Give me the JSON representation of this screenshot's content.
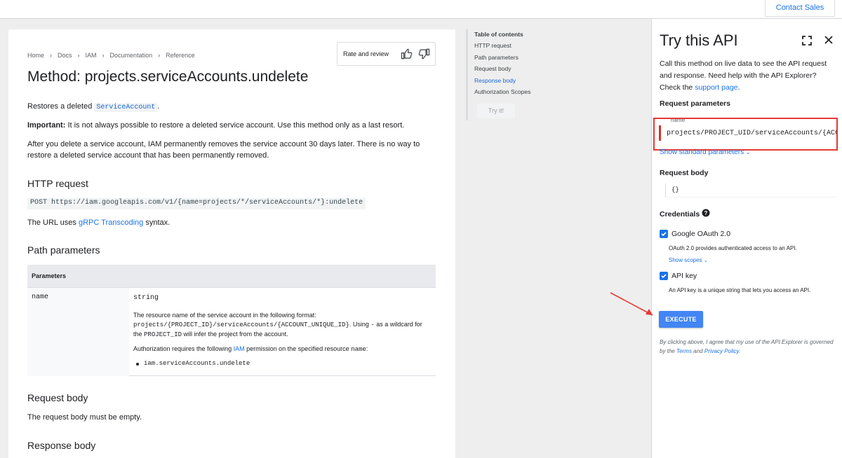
{
  "topbar": {
    "contact_sales": "Contact Sales"
  },
  "breadcrumb": [
    "Home",
    "Docs",
    "IAM",
    "Documentation",
    "Reference"
  ],
  "rate": {
    "label": "Rate and review"
  },
  "article": {
    "title": "Method: projects.serviceAccounts.undelete",
    "intro_prefix": "Restores a deleted ",
    "intro_code": "ServiceAccount",
    "intro_suffix": ".",
    "important_label": "Important:",
    "important_text": " It is not always possible to restore a deleted service account. Use this method only as a last resort.",
    "after_delete": "After you delete a service account, IAM permanently removes the service account 30 days later. There is no way to restore a deleted service account that has been permanently removed.",
    "http_heading": "HTTP request",
    "http_line": "POST https://iam.googleapis.com/v1/{name=projects/*/serviceAccounts/*}:undelete",
    "url_prefix": "The URL uses ",
    "url_link": "gRPC Transcoding",
    "url_suffix": " syntax.",
    "path_heading": "Path parameters",
    "table": {
      "header": "Parameters",
      "param_name": "name",
      "param_type": "string",
      "desc_1": "The resource name of the service account in the following format:",
      "desc_format": "projects/{PROJECT_ID}/serviceAccounts/{ACCOUNT_UNIQUE_ID}",
      "desc_using": ". Using ",
      "desc_dash": "-",
      "desc_wildcard": " as a wildcard for the ",
      "desc_project": "PROJECT_ID",
      "desc_infer": " will infer the project from the account.",
      "auth_prefix": "Authorization requires the following ",
      "auth_link": "IAM",
      "auth_suffix": " permission on the specified resource ",
      "auth_name": "name",
      "auth_end": ":",
      "permission": "iam.serviceAccounts.undelete"
    },
    "request_heading": "Request body",
    "request_text": "The request body must be empty.",
    "response_heading": "Response body"
  },
  "toc": {
    "title": "Table of contents",
    "items": [
      "HTTP request",
      "Path parameters",
      "Request body",
      "Response body",
      "Authorization Scopes"
    ],
    "active_index": 3,
    "try_button": "Try it!"
  },
  "api": {
    "title": "Try this API",
    "desc_prefix": "Call this method on live data to see the API request and response. Need help with the API Explorer? Check the ",
    "support_link": "support page",
    "desc_suffix": ".",
    "request_params_heading": "Request parameters",
    "name_label": "name",
    "name_value": "projects/PROJECT_UID/serviceAccounts/{ACC",
    "show_standard": "Show standard parameters",
    "request_body_heading": "Request body",
    "request_body_value": "{}",
    "credentials_heading": "Credentials",
    "oauth_label": "Google OAuth 2.0",
    "oauth_desc": "OAuth 2.0 provides authenticated access to an API.",
    "show_scopes": "Show scopes",
    "apikey_label": "API key",
    "apikey_desc": "An API key is a unique string that lets you access an API.",
    "execute": "EXECUTE",
    "disclaimer_prefix": "By clicking above, I agree that my use of the API Explorer is governed by the ",
    "terms_link": "Terms",
    "disclaimer_and": " and ",
    "privacy_link": "Privacy Policy",
    "disclaimer_suffix": "."
  },
  "colors": {
    "accent": "#1a73e8",
    "execute_button": "#4285f4",
    "highlight_red": "#e53935"
  },
  "icons": [
    "thumb-up-icon",
    "thumb-down-icon",
    "expand-icon",
    "close-icon",
    "help-icon",
    "checkbox-checked-icon",
    "chevron-right-icon",
    "chevron-down-icon"
  ]
}
